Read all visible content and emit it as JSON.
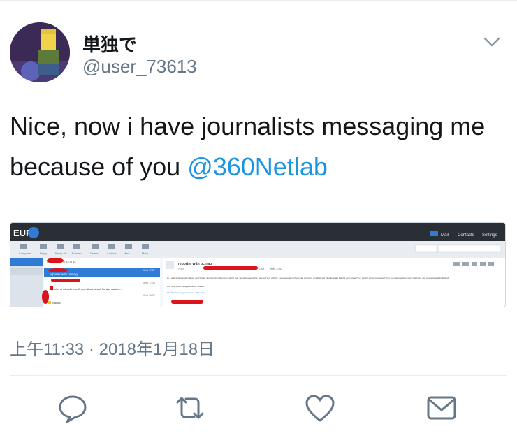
{
  "tweet": {
    "display_name": "単独で",
    "handle": "@user_73613",
    "text_before": "Nice, now i have journalists messaging me because of you ",
    "mention": "@360Netlab",
    "timestamp": "上午11:33 · 2018年1月18日"
  },
  "screenshot": {
    "app_logo": "EUP",
    "toolbar_labels": [
      "Compose",
      "Reply",
      "Reply all",
      "Forward",
      "Delete",
      "Archive",
      "Mark",
      "More"
    ],
    "list_header": "Messages 1 to 33 of 44",
    "list_items": [
      {
        "subject": "reporter with pcmag",
        "date": "Wed 17:57",
        "selected": true
      },
      {
        "subject": "",
        "date": "Wed 17:44",
        "selected": false
      },
      {
        "subject": "reporter on deadline with questions about Sanlan variant...",
        "date": "Wed 16:37",
        "selected": false
      },
      {
        "subject": "Sanlan",
        "date": "",
        "selected": false
      }
    ],
    "header_links": [
      "Mail",
      "Contacts",
      "Settings"
    ],
    "message_subject": "reporter with pcmag",
    "message_from_label": "From",
    "message_date_label": "Date",
    "message_date": "Wed 17:57",
    "message_body": "Hi, I was writing a story about your botnet reporting the Ethereum mining rigs. Security researchers spotted your activity. I was wondering if you can comment on what your intentions are behind your botnet? Is it just for mining purposes? Can you disclose how many Claymore rigs you've targeted/infected?",
    "message_body2": "Any help would be appreciated. Thanks!",
    "message_link": "http://www.pcmag.com/news/...(link text)"
  },
  "actions": {
    "reply": "reply-icon",
    "retweet": "retweet-icon",
    "like": "heart-icon",
    "dm": "envelope-icon"
  },
  "colors": {
    "text": "#14171a",
    "secondary": "#657786",
    "link": "#1b95e0",
    "redaction": "#d9151b",
    "mail_dark": "#2a2f36",
    "mail_accent": "#2f7bd6"
  }
}
